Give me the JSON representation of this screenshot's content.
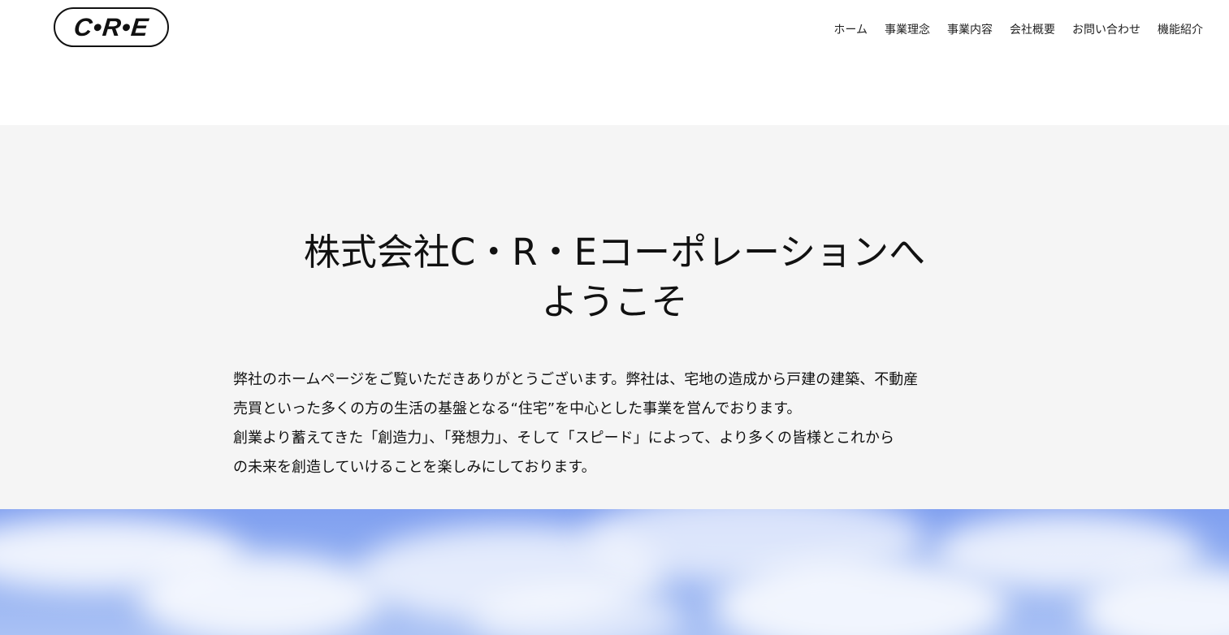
{
  "header": {
    "logo_text": "C•R•E",
    "nav": [
      {
        "label": "ホーム",
        "name": "nav-item-home"
      },
      {
        "label": "事業理念",
        "name": "nav-item-philosophy"
      },
      {
        "label": "事業内容",
        "name": "nav-item-business"
      },
      {
        "label": "会社概要",
        "name": "nav-item-company"
      },
      {
        "label": "お問い合わせ",
        "name": "nav-item-contact"
      },
      {
        "label": "機能紹介",
        "name": "nav-item-features"
      }
    ]
  },
  "intro": {
    "title_line1": "株式会社C・R・Eコーポレーションへ",
    "title_line2": "ようこそ",
    "body_lines": [
      "弊社のホームページをご覧いただきありがとうございます。弊社は、宅地の造成から戸建の建築、不動産",
      "売買といった多くの方の生活の基盤となる“住宅”を中心とした事業を営んでおります。",
      "創業より蓄えてきた「創造力」、「発想力」、そして「スピード」によって、より多くの皆様とこれから",
      "の未来を創造していけることを楽しみにしております。"
    ]
  },
  "colors": {
    "intro_background": "#f5f5f5",
    "sky_top": "#7f9ff0",
    "sky_bottom": "#a9c1f4",
    "text": "#111111"
  }
}
